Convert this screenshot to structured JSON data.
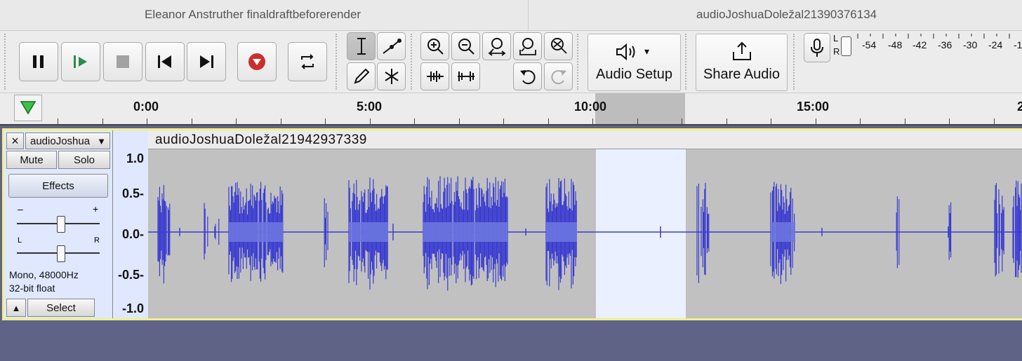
{
  "window": {
    "left_title": "Eleanor Anstruther finaldraftbeforerender",
    "right_title": "audioJoshuaDoležal21390376134"
  },
  "transport": {
    "pause": "pause-icon",
    "play": "play-icon",
    "stop": "stop-icon",
    "skip_start": "skip-start-icon",
    "skip_end": "skip-end-icon",
    "record": "record-icon",
    "loop": "loop-icon"
  },
  "tools": [
    "selection-tool",
    "envelope-tool",
    "draw-tool",
    "multi-tool"
  ],
  "zoom": [
    "zoom-in",
    "zoom-out",
    "fit-selection",
    "fit-project",
    "zoom-toggle",
    "trim",
    "silence",
    "undo",
    "redo"
  ],
  "audio_setup": {
    "label": "Audio Setup",
    "arrow": "▾"
  },
  "share_audio": {
    "label": "Share Audio"
  },
  "meter": {
    "lr_top": "L",
    "lr_bottom": "R",
    "labels": [
      "-54",
      "-48",
      "-42",
      "-36",
      "-30",
      "-24",
      "-1"
    ]
  },
  "timeline": {
    "labels": [
      "0:00",
      "5:00",
      "10:00",
      "15:00",
      "2"
    ],
    "selection_start": "9:54",
    "selection_end": "11:55"
  },
  "track": {
    "close": "×",
    "name": "audioJoshua",
    "dropdown": "▼",
    "mute": "Mute",
    "solo": "Solo",
    "effects": "Effects",
    "gain_minus": "–",
    "gain_plus": "+",
    "pan_l": "L",
    "pan_r": "R",
    "info_line1": "Mono, 48000Hz",
    "info_line2": "32-bit float",
    "collapse": "▲",
    "select": "Select",
    "scale": [
      "1.0",
      "0.5-",
      "0.0-",
      "-0.5-",
      "-1.0"
    ],
    "clip_name": "audioJoshuaDoležal21942937339"
  },
  "colors": {
    "waveform": "#3a3ccf",
    "waveform_rms": "#6f78e0",
    "track_bg": "#c1c1c1",
    "selection": "#eaf0ff",
    "border_focus": "#f2ee8b",
    "record_red": "#c9302c"
  }
}
